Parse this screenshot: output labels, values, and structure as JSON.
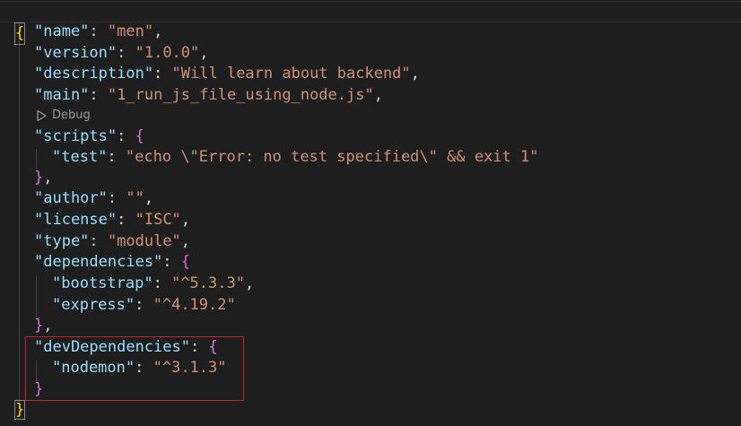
{
  "editor": {
    "brace_open": "{",
    "brace_close": "}",
    "colon": ": ",
    "comma": ",",
    "lines": {
      "name": {
        "key": "\"name\"",
        "value": "\"men\""
      },
      "version": {
        "key": "\"version\"",
        "value": "\"1.0.0\""
      },
      "description": {
        "key": "\"description\"",
        "value": "\"Will learn about backend\""
      },
      "main": {
        "key": "\"main\"",
        "value": "\"1_run_js_file_using_node.js\""
      },
      "scripts": {
        "key": "\"scripts\""
      },
      "test": {
        "key": "\"test\"",
        "value": "\"echo \\\"Error: no test specified\\\" && exit 1\""
      },
      "author": {
        "key": "\"author\"",
        "value": "\"\""
      },
      "license": {
        "key": "\"license\"",
        "value": "\"ISC\""
      },
      "type": {
        "key": "\"type\"",
        "value": "\"module\""
      },
      "dependencies": {
        "key": "\"dependencies\""
      },
      "bootstrap": {
        "key": "\"bootstrap\"",
        "value": "\"^5.3.3\""
      },
      "express": {
        "key": "\"express\"",
        "value": "\"^4.19.2\""
      },
      "devDependencies": {
        "key": "\"devDependencies\""
      },
      "nodemon": {
        "key": "\"nodemon\"",
        "value": "\"^3.1.3\""
      }
    }
  },
  "codelens": {
    "label": "Debug",
    "icon": "debug-play-icon"
  },
  "colors": {
    "background": "#1e1e1e",
    "key": "#9cdcfe",
    "string": "#ce9178",
    "brace_level_1": "#ffd700",
    "brace_level_2": "#da70d6",
    "highlight_box": "#c5252b"
  }
}
